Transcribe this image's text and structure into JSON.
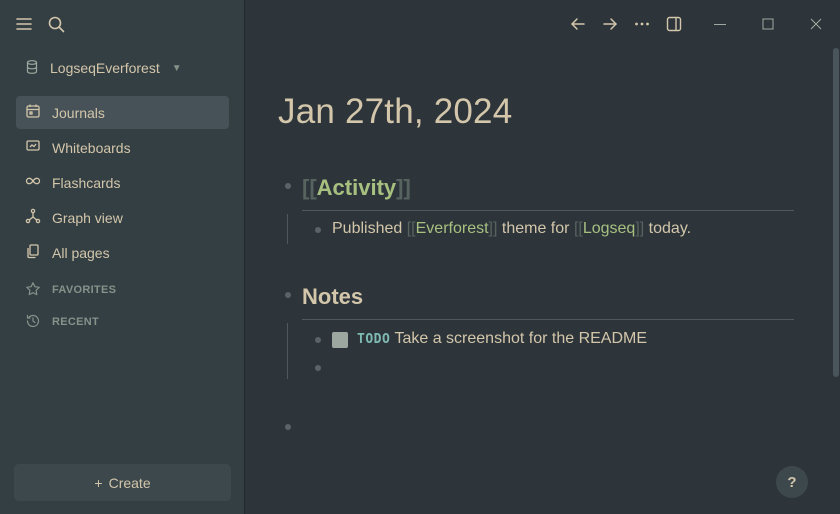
{
  "sidebar": {
    "graph_name": "LogseqEverforest",
    "nav_items": [
      {
        "label": "Journals",
        "icon": "calendar-icon",
        "active": true
      },
      {
        "label": "Whiteboards",
        "icon": "whiteboard-icon",
        "active": false
      },
      {
        "label": "Flashcards",
        "icon": "infinity-icon",
        "active": false
      },
      {
        "label": "Graph view",
        "icon": "graph-icon",
        "active": false
      },
      {
        "label": "All pages",
        "icon": "pages-icon",
        "active": false
      }
    ],
    "favorites_label": "FAVORITES",
    "recent_label": "RECENT",
    "create_label": "Create",
    "create_prefix": "+"
  },
  "page": {
    "title": "Jan 27th, 2024",
    "activity": {
      "open": "[[",
      "label": "Activity",
      "close": "]]"
    },
    "activity_child": {
      "prefix": "Published",
      "link1_open": "[[",
      "link1": "Everforest",
      "link1_close": "]]",
      "middle": "theme for",
      "link2_open": "[[",
      "link2": "Logseq",
      "link2_close": "]]",
      "suffix": "today."
    },
    "notes_heading": "Notes",
    "todo": {
      "marker": "TODO",
      "text": "Take a screenshot for the README"
    }
  },
  "help_label": "?",
  "colors": {
    "background": "#2d353b",
    "sidebar": "#343f44",
    "accent_green": "#a7c080",
    "todo_blue": "#7fbbb3",
    "text": "#d3c6aa"
  }
}
